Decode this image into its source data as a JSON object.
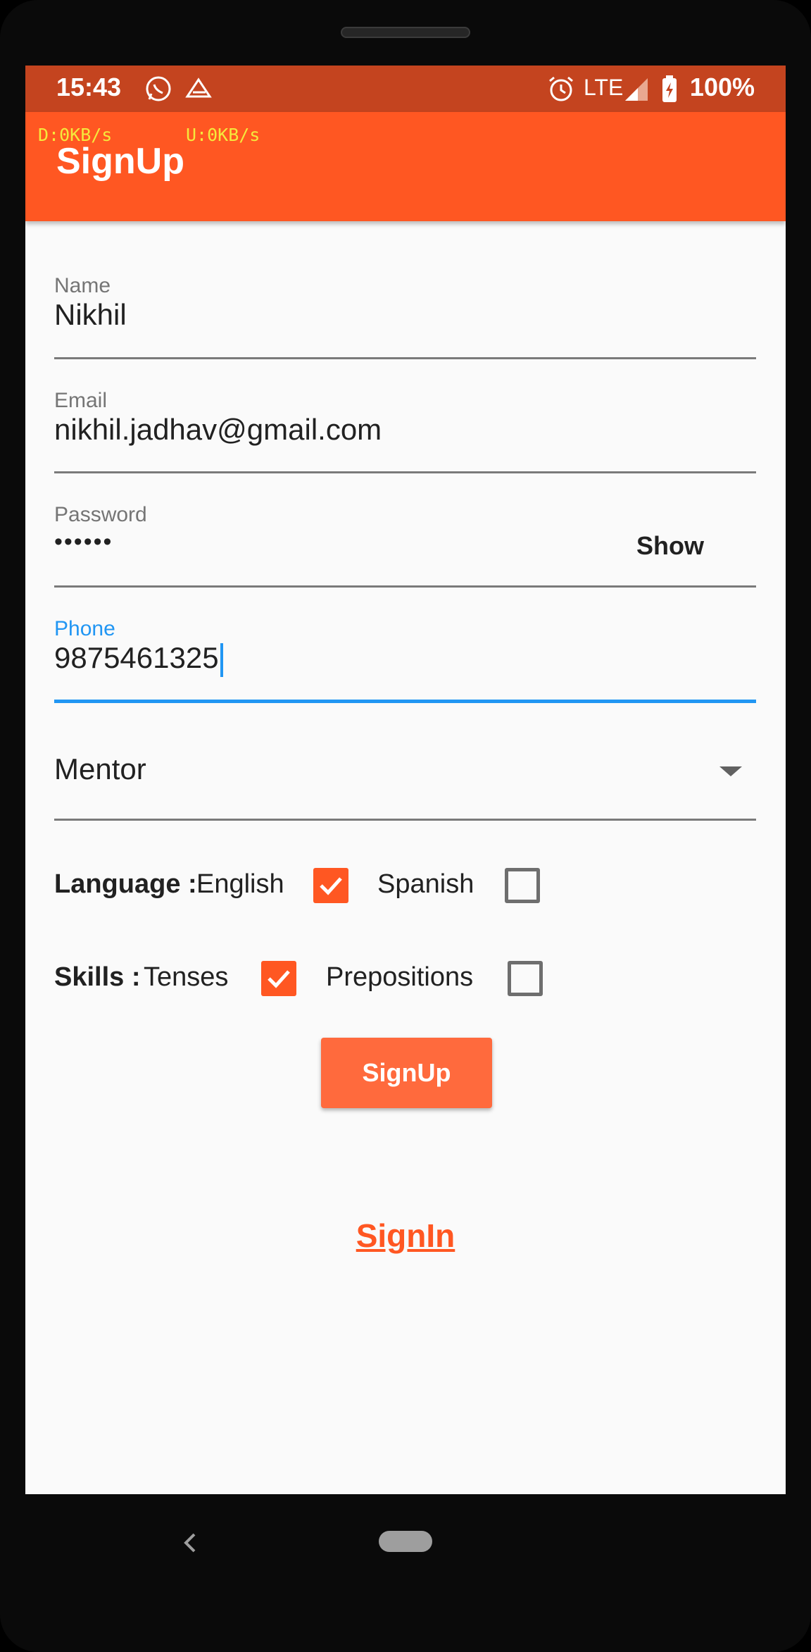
{
  "status_bar": {
    "time": "15:43",
    "network": "LTE",
    "battery": "100%",
    "icons": [
      "whatsapp-icon",
      "app-icon",
      "alarm-icon",
      "signal-icon",
      "battery-icon"
    ]
  },
  "net_speed": {
    "down": "D:0KB/s",
    "up": "U:0KB/s"
  },
  "app_bar": {
    "title": "SignUp"
  },
  "form": {
    "name": {
      "label": "Name",
      "value": "Nikhil"
    },
    "email": {
      "label": "Email",
      "value": "nikhil.jadhav@gmail.com"
    },
    "password": {
      "label": "Password",
      "value": "••••••",
      "toggle": "Show"
    },
    "phone": {
      "label": "Phone",
      "value": "9875461325"
    },
    "role": {
      "value": "Mentor"
    },
    "language": {
      "label": "Language :",
      "options": [
        {
          "label": "English",
          "checked": true
        },
        {
          "label": "Spanish",
          "checked": false
        }
      ]
    },
    "skills": {
      "label": "Skills :",
      "options": [
        {
          "label": "Tenses",
          "checked": true
        },
        {
          "label": "Prepositions",
          "checked": false
        }
      ]
    }
  },
  "actions": {
    "signup_label": "SignUp",
    "signin_label": "SignIn"
  },
  "colors": {
    "primary": "#ff5722",
    "status_bar": "#c4441f",
    "accent": "#2196f3"
  }
}
